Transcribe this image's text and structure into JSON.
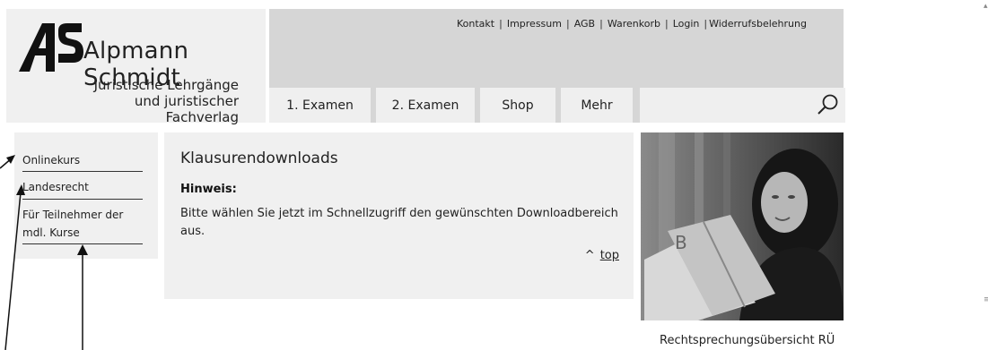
{
  "logo": {
    "brand": "Alpmann Schmidt",
    "mark_text": "AS",
    "tagline_1": "Juristische Lehrgänge",
    "tagline_2": "und juristischer Fachverlag"
  },
  "topnav": {
    "items": [
      "Kontakt",
      "Impressum",
      "AGB",
      "Warenkorb",
      "Login",
      "Widerrufsbelehrung"
    ]
  },
  "tabs": [
    "1. Examen",
    "2. Examen",
    "Shop",
    "Mehr"
  ],
  "search": {
    "value": "",
    "icon": "search-icon"
  },
  "sidebar": {
    "items": [
      {
        "label": "Onlinekurs"
      },
      {
        "label": "Landesrecht"
      },
      {
        "label_1": "Für Teilnehmer der",
        "label_2": "mdl. Kurse"
      }
    ]
  },
  "main": {
    "title": "Klausurendownloads",
    "hint_label": "Hinweis:",
    "text": "Bitte wählen Sie jetzt im Schnellzugriff den gewünschten Downloadbereich aus.",
    "top_caret": "^",
    "top_label": "top"
  },
  "promo": {
    "caption": "Rechtsprechungsübersicht RÜ",
    "book_letter": "B"
  },
  "colors": {
    "header_gray": "#d6d6d6",
    "panel_gray": "#f0f0f0",
    "text": "#222222"
  }
}
